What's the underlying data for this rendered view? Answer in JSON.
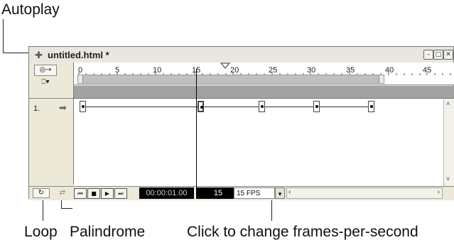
{
  "callouts": {
    "autoplay": "Autoplay",
    "loop": "Loop",
    "palindrome": "Palindrome",
    "fps_hint": "Click to change frames-per-second"
  },
  "window": {
    "title": "untitled.html *",
    "title_icon": "timeline-icon",
    "buttons": [
      "minimize-icon",
      "maximize-icon",
      "close-icon"
    ]
  },
  "ruler": {
    "ticks": [
      "0",
      "5",
      "10",
      "15",
      "20",
      "25",
      "30",
      "35",
      "40",
      "45"
    ]
  },
  "channel": {
    "number": "1.",
    "arrow_icon": "arrow-right-icon",
    "keyframe_count": 5
  },
  "status": {
    "time": "00:00:01.00",
    "frame": "15",
    "fps": "15 FPS"
  }
}
